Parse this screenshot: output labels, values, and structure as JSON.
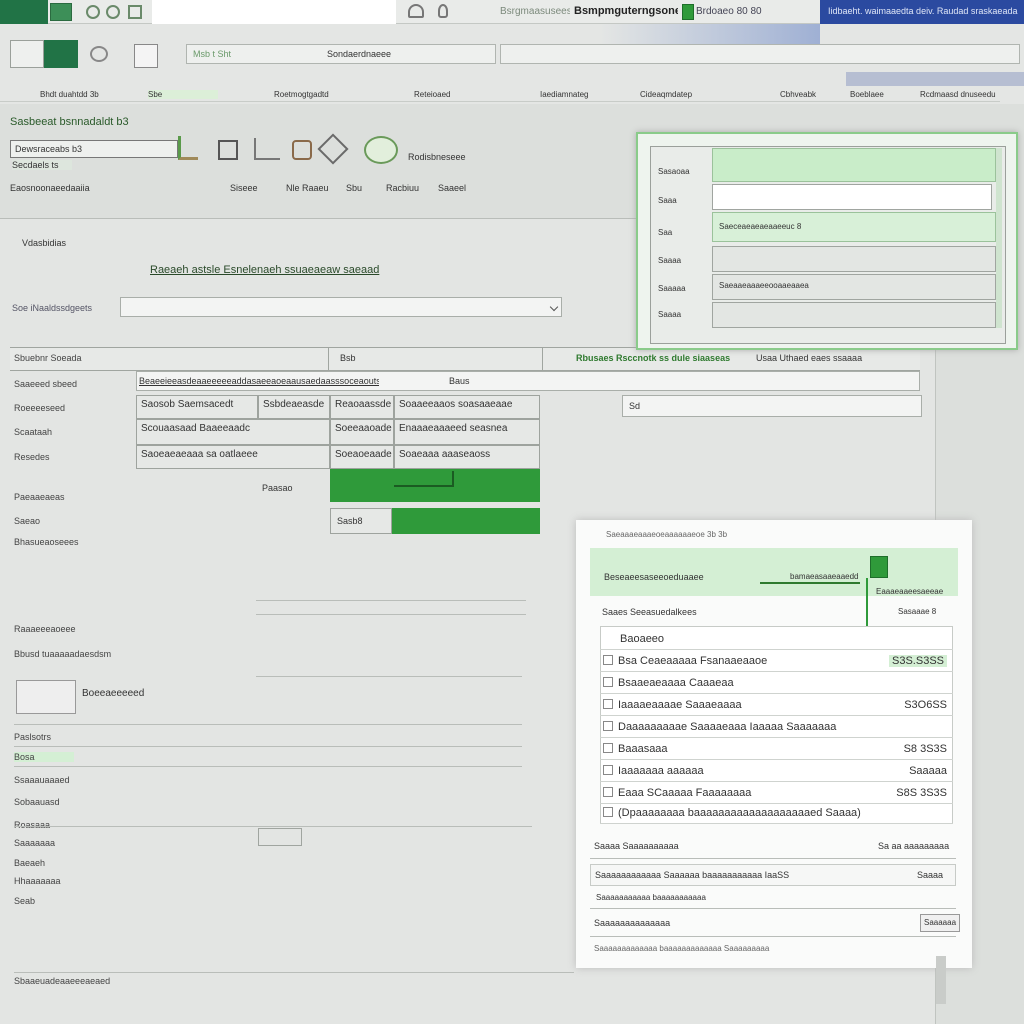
{
  "titlebar": {
    "doc_title": "Bsmpmguterngsone",
    "search_text": "Bsrgmaasuseesue",
    "account_text": "Iidbaeht. waimaaedta deiv. Raudad sraskaeada",
    "mode_label": "Brdoaeo 80 80"
  },
  "ribbon": {
    "tabs": [
      "Bhdt duahtdd 3b",
      "Sbe",
      "Roetmogtgadtd",
      "Reteioaed",
      "Iaediamnateg",
      "Cideaqmdatep",
      "Cbhveabk",
      "Boeblaee",
      "Rcdmaasd dnuseedu"
    ],
    "formula_text": "Sondaerdnaeee",
    "namebox_text": "Msb t Sht"
  },
  "toolbar2": {
    "group_title": "Sasbeeat bsnnadaldt b3",
    "input_text": "Dewsraceabs b3",
    "sub_label": "Secdaels ts",
    "icon_label": "Rodisbneseee",
    "breadcrumb": "Eaosnoonaeedaaiia",
    "links": [
      "Siseee",
      "Nle Raaeu",
      "Sbu",
      "Racbiuu",
      "Saaeel"
    ]
  },
  "form": {
    "section": "Vdasbidias",
    "heading": "Raeaeh astsle Esnelenaeh  ssuaeaeaw saeaad",
    "search_label": "Soe iNaaldssdgeets",
    "search_value": "",
    "row_labels": [
      "Sbuebnr Soeada",
      "Saaeeed sbeed",
      "Roeeeeseed",
      "Scaataah",
      "Resedes",
      "Paeaaeaeas",
      "Bhasueaoseees",
      "Saeao",
      "Raaaeeeaoeee",
      "Bbusd tuaaaaadaesdsm",
      "Paslsotrs",
      "Bosa",
      "Ssaaauaaaed",
      "Sobaauasd",
      "Roasaaa",
      "Saaaaaaa",
      "Baeaeh",
      "Hhaaaaaaa",
      "Seab",
      "Sbaaeuadeaaeeeaeaed"
    ],
    "top_right_header": "Rbusaes Rsccnotk ss dule siaaseas",
    "top_right_aux": "Usaa  Uthaed eaes ssaaaa",
    "col1_head": "Bsb",
    "long_value": "Beaeeieeasdeaaeeeeeaddasaeeaoeaausaedaasssoceaouts5",
    "small_value": "Baus",
    "grid": [
      [
        "Saosob Saemsacedt",
        "Ssbdeaeasde",
        "Reaoaassde",
        "Soaaeeaaos soasaaeaae"
      ],
      [
        "Scouaasaad Baaeeaadc",
        "",
        "Soeeaaoade",
        "Enaaaeaaaeed seasnea"
      ],
      [
        "Saoeaeaeaaa sa oatlaeee",
        "",
        "Soeaoeaade",
        "Soaeaaa aaaseaoss"
      ]
    ],
    "side_value": "Sd",
    "label_a": "Paasao",
    "label_b": "Boeeaeeeeed",
    "value_field": "Sasb8"
  },
  "popup_panel": {
    "rows": [
      "Sasaoaa",
      "Saaa",
      "Saa",
      "Saaaa",
      "Saaaaa",
      "Saaaa"
    ],
    "green_value": "Saeceaeaeaeaaeeuc 8",
    "second_value": "Saeaaeaaaeeooaaeaaea"
  },
  "side_panel": {
    "header_small": "Saeaaaeaaaeoeaaaaaaeoe 3b 3b",
    "green_title": "Beseaeesaseeoeduaaee",
    "green_sub": "bamaeasaaeaaedd",
    "green_right": "Eaaaeaaeesaeeae",
    "section": "Saaes Seeasuedalkees",
    "section_right": "Sasaaae 8",
    "list_header": "Baoaeeo",
    "items": [
      {
        "label": "Bsa  Ceaeaaaaa Fsanaaeaaoe",
        "value": "S3S.S3SS"
      },
      {
        "label": "Bsaaeaeaaaa Caaaeaa",
        "value": ""
      },
      {
        "label": "Iaaaaeaaaae Saaaeaaaa",
        "value": "S3O6SS"
      },
      {
        "label": "Daaaaaaaaae Saaaaeaaa Iaaaaa Saaaaaaa",
        "value": ""
      },
      {
        "label": "Baaasaaa",
        "value": "S8 3S3S"
      },
      {
        "label": "Iaaaaaaa aaaaaa",
        "value": "Saaaaa"
      },
      {
        "label": "Eaaa SCaaaaa Faaaaaaaa",
        "value": "S8S 3S3S"
      },
      {
        "label": "(Dpaaaaaaaa baaaaaaaaaaaaaaaaaaaed Saaaa)",
        "value": ""
      }
    ],
    "footer1": "Saaaa Saaaaaaaaaa",
    "footer1_right": "Sa aa aaaaaaaaa",
    "footer2": "Saaaaaaaaaaaa  Saaaaaa baaaaaaaaaaa IaaSS",
    "footer2_right": "Saaaa",
    "footer3": "Saaaaaaaaaaa baaaaaaaaaaa",
    "footer4": "Saaaaaaaaaaaaaa",
    "footer4_button": "Saaaaaa",
    "footer5": "Saaaaaaaaaaaaa baaaaaaaaaaaaa Saaaaaaaaa"
  },
  "colors": {
    "accent_green": "#2f9a3a",
    "excel_green": "#217346",
    "title_blue": "#2b4aa0",
    "light_green": "#d4efd4"
  }
}
